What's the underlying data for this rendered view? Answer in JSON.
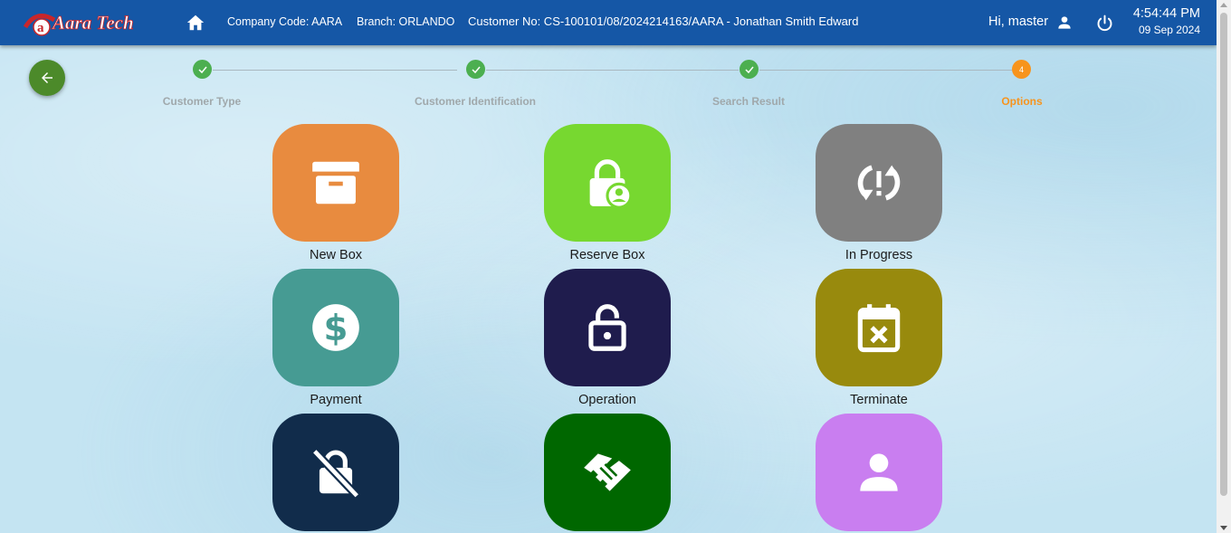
{
  "header": {
    "logo_text": "Aara Tech",
    "company_code": "Company Code: AARA",
    "branch": "Branch: ORLANDO",
    "customer": "Customer No: CS-100101/08/2024214163/AARA - Jonathan Smith Edward",
    "greeting": "Hi, master",
    "time": "4:54:44 PM",
    "date": "09 Sep 2024",
    "icons": [
      "home-icon",
      "user-icon",
      "power-icon"
    ]
  },
  "back_button": {
    "icon": "arrow-left-icon"
  },
  "stepper": {
    "steps": [
      {
        "label": "Customer Type",
        "state": "done"
      },
      {
        "label": "Customer Identification",
        "state": "done"
      },
      {
        "label": "Search Result",
        "state": "done"
      },
      {
        "label": "Options",
        "state": "active",
        "number": "4"
      }
    ]
  },
  "options": [
    {
      "label": "New Box",
      "color": "#e88b3f",
      "icon": "archive-box-icon"
    },
    {
      "label": "Reserve Box",
      "color": "#77d830",
      "icon": "lock-user-icon"
    },
    {
      "label": "In Progress",
      "color": "#808080",
      "icon": "sync-problem-icon"
    },
    {
      "label": "Payment",
      "color": "#469b93",
      "icon": "dollar-circle-icon"
    },
    {
      "label": "Operation",
      "color": "#1f1c4d",
      "icon": "lock-open-icon"
    },
    {
      "label": "Terminate",
      "color": "#988a0d",
      "icon": "calendar-x-icon"
    },
    {
      "label": "",
      "color": "#112c4b",
      "icon": "lock-off-icon"
    },
    {
      "label": "",
      "color": "#006700",
      "icon": "handshake-icon"
    },
    {
      "label": "",
      "color": "#c97ef0",
      "icon": "person-icon"
    }
  ],
  "colors": {
    "header_bg": "#1557a6",
    "step_done": "#4caf50",
    "step_active": "#f7941d",
    "back_button": "#4c8a2a"
  }
}
